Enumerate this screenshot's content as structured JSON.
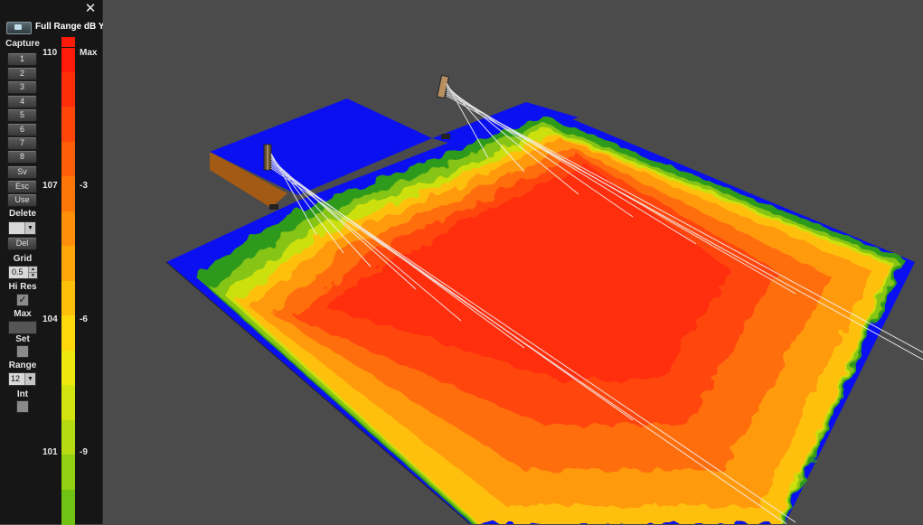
{
  "panel": {
    "close_glyph": "✕",
    "title": "Full Range dB Y",
    "capture_label": "Capture",
    "capture_buttons": [
      "1",
      "2",
      "3",
      "4",
      "5",
      "6",
      "7",
      "8"
    ],
    "sv_label": "Sv",
    "esc_label": "Esc",
    "use_label": "Use",
    "delete_label": "Delete",
    "delete_select_value": "",
    "del_label": "Del",
    "grid_label": "Grid",
    "grid_value": "0.5",
    "hires_label": "Hi Res",
    "hires_checked": true,
    "max_label": "Max",
    "set_label": "Set",
    "set_checked": false,
    "range_label": "Range",
    "range_value": "12",
    "int_label": "Int",
    "int_checked": false
  },
  "scale": {
    "db_ticks": [
      "110",
      "107",
      "104",
      "101"
    ],
    "rel_ticks": [
      "Max",
      "-3",
      "-6",
      "-9"
    ],
    "colors": [
      "#ff1a0a",
      "#ff2e0a",
      "#ff460a",
      "#ff5e08",
      "#ff7608",
      "#ff8e08",
      "#ffa808",
      "#ffc00a",
      "#ffd80c",
      "#eee80e",
      "#d2e410",
      "#b4dc10",
      "#92d012",
      "#70c214"
    ]
  },
  "viewport": {
    "background": "#4b4b4b",
    "out_of_range_color": "#0a10f0",
    "icons": [
      "speaker-array-left-icon",
      "speaker-array-right-icon"
    ]
  }
}
